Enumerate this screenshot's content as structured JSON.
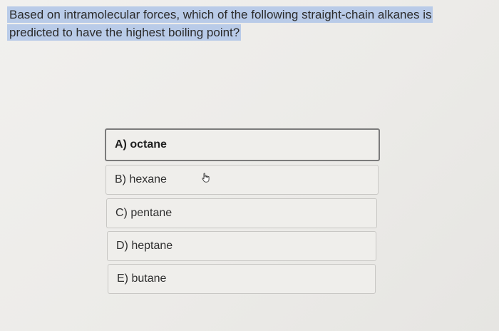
{
  "question": {
    "text": "Based on intramolecular forces, which of the following straight-chain alkanes is predicted to have the highest boiling point?"
  },
  "options": [
    {
      "label": "A) octane",
      "selected": true
    },
    {
      "label": "B) hexane",
      "selected": false
    },
    {
      "label": "C) pentane",
      "selected": false
    },
    {
      "label": "D) heptane",
      "selected": false
    },
    {
      "label": "E) butane",
      "selected": false
    }
  ],
  "cursor": {
    "icon": "hand-pointer-icon"
  }
}
